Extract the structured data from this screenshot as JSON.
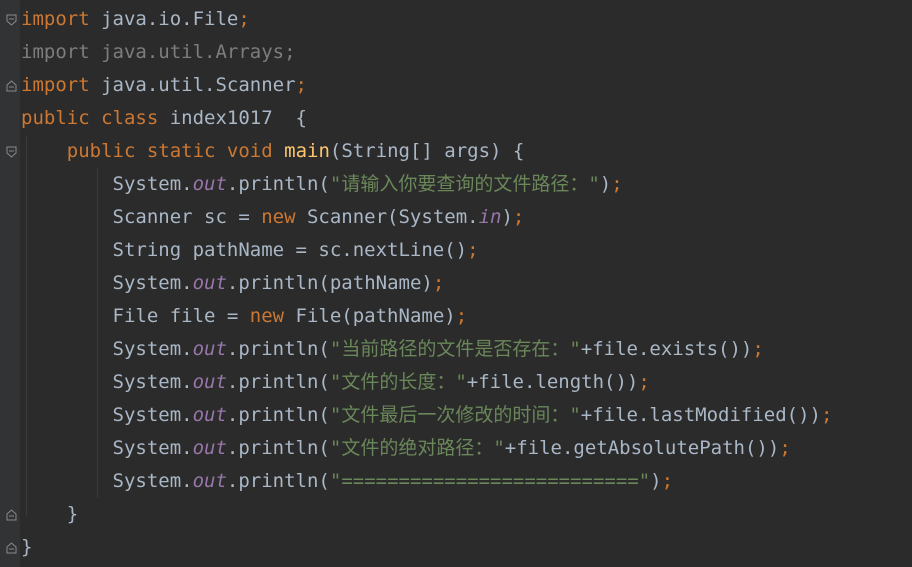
{
  "editor": {
    "colors": {
      "background": "#2b2b2b",
      "keyword": "#cc7832",
      "method_decl": "#ffc66d",
      "static_field": "#9876aa",
      "string": "#6a8759",
      "text": "#a9b7c6",
      "unused_import": "#7d7d7d"
    },
    "lines": [
      {
        "tokens": [
          {
            "t": "import",
            "c": "kw"
          },
          {
            "t": " java.io.File",
            "c": "plain"
          },
          {
            "t": ";",
            "c": "kw"
          }
        ]
      },
      {
        "tokens": [
          {
            "t": "import",
            "c": "dim"
          },
          {
            "t": " java.util.Arrays;",
            "c": "dim"
          }
        ]
      },
      {
        "tokens": [
          {
            "t": "import",
            "c": "kw"
          },
          {
            "t": " java.util.Scanner",
            "c": "plain"
          },
          {
            "t": ";",
            "c": "kw"
          }
        ]
      },
      {
        "tokens": [
          {
            "t": "public class",
            "c": "kw"
          },
          {
            "t": " index1017  {",
            "c": "plain"
          }
        ]
      },
      {
        "tokens": [
          {
            "t": "    ",
            "c": "plain"
          },
          {
            "t": "public static void",
            "c": "kw"
          },
          {
            "t": " ",
            "c": "plain"
          },
          {
            "t": "main",
            "c": "fn"
          },
          {
            "t": "(String[] args) {",
            "c": "plain"
          }
        ]
      },
      {
        "tokens": [
          {
            "t": "        System.",
            "c": "plain"
          },
          {
            "t": "out",
            "c": "fld"
          },
          {
            "t": ".println(",
            "c": "plain"
          },
          {
            "t": "\"请输入你要查询的文件路径：\"",
            "c": "str"
          },
          {
            "t": ")",
            "c": "plain"
          },
          {
            "t": ";",
            "c": "kw"
          }
        ]
      },
      {
        "tokens": [
          {
            "t": "        Scanner sc = ",
            "c": "plain"
          },
          {
            "t": "new",
            "c": "kw"
          },
          {
            "t": " Scanner(System.",
            "c": "plain"
          },
          {
            "t": "in",
            "c": "fld"
          },
          {
            "t": ")",
            "c": "plain"
          },
          {
            "t": ";",
            "c": "kw"
          }
        ]
      },
      {
        "tokens": [
          {
            "t": "        String pathName = sc.nextLine()",
            "c": "plain"
          },
          {
            "t": ";",
            "c": "kw"
          }
        ]
      },
      {
        "tokens": [
          {
            "t": "        System.",
            "c": "plain"
          },
          {
            "t": "out",
            "c": "fld"
          },
          {
            "t": ".println(pathName)",
            "c": "plain"
          },
          {
            "t": ";",
            "c": "kw"
          }
        ]
      },
      {
        "tokens": [
          {
            "t": "        File file = ",
            "c": "plain"
          },
          {
            "t": "new",
            "c": "kw"
          },
          {
            "t": " File(pathName)",
            "c": "plain"
          },
          {
            "t": ";",
            "c": "kw"
          }
        ]
      },
      {
        "tokens": [
          {
            "t": "        System.",
            "c": "plain"
          },
          {
            "t": "out",
            "c": "fld"
          },
          {
            "t": ".println(",
            "c": "plain"
          },
          {
            "t": "\"当前路径的文件是否存在：\"",
            "c": "str"
          },
          {
            "t": "+file.exists())",
            "c": "plain"
          },
          {
            "t": ";",
            "c": "kw"
          }
        ]
      },
      {
        "tokens": [
          {
            "t": "        System.",
            "c": "plain"
          },
          {
            "t": "out",
            "c": "fld"
          },
          {
            "t": ".println(",
            "c": "plain"
          },
          {
            "t": "\"文件的长度：\"",
            "c": "str"
          },
          {
            "t": "+file.length())",
            "c": "plain"
          },
          {
            "t": ";",
            "c": "kw"
          }
        ]
      },
      {
        "tokens": [
          {
            "t": "        System.",
            "c": "plain"
          },
          {
            "t": "out",
            "c": "fld"
          },
          {
            "t": ".println(",
            "c": "plain"
          },
          {
            "t": "\"文件最后一次修改的时间：\"",
            "c": "str"
          },
          {
            "t": "+file.lastModified())",
            "c": "plain"
          },
          {
            "t": ";",
            "c": "kw"
          }
        ]
      },
      {
        "tokens": [
          {
            "t": "        System.",
            "c": "plain"
          },
          {
            "t": "out",
            "c": "fld"
          },
          {
            "t": ".println(",
            "c": "plain"
          },
          {
            "t": "\"文件的绝对路径：\"",
            "c": "str"
          },
          {
            "t": "+file.getAbsolutePath())",
            "c": "plain"
          },
          {
            "t": ";",
            "c": "kw"
          }
        ]
      },
      {
        "tokens": [
          {
            "t": "        System.",
            "c": "plain"
          },
          {
            "t": "out",
            "c": "fld"
          },
          {
            "t": ".println(",
            "c": "plain"
          },
          {
            "t": "\"==========================\"",
            "c": "str"
          },
          {
            "t": ")",
            "c": "plain"
          },
          {
            "t": ";",
            "c": "kw"
          }
        ]
      },
      {
        "tokens": [
          {
            "t": "    }",
            "c": "plain"
          }
        ]
      },
      {
        "tokens": [
          {
            "t": "}",
            "c": "plain"
          }
        ]
      }
    ]
  },
  "gutter": {
    "fold_markers": [
      {
        "line": 1,
        "icon": "fold-open-icon"
      },
      {
        "line": 3,
        "icon": "fold-close-icon"
      },
      {
        "line": 5,
        "icon": "fold-open-icon"
      },
      {
        "line": 16,
        "icon": "fold-close-icon"
      },
      {
        "line": 17,
        "icon": "fold-close-icon"
      }
    ]
  }
}
